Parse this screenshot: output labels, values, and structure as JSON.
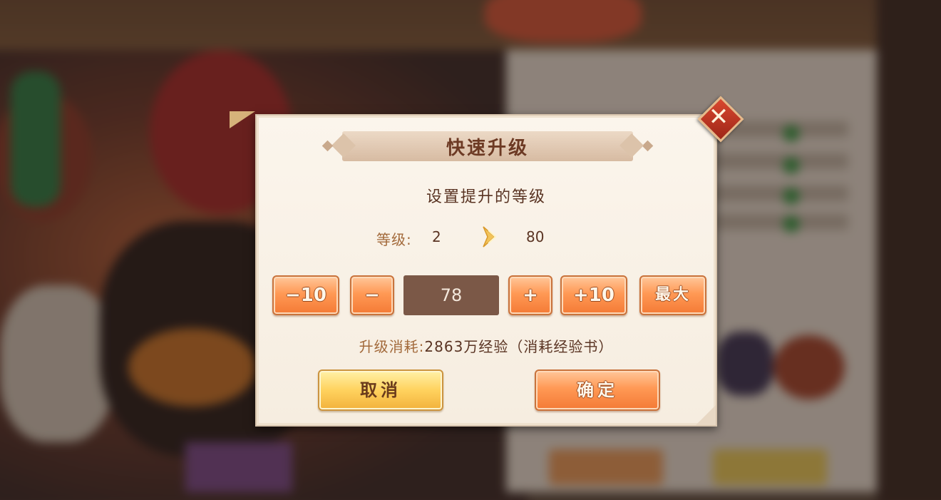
{
  "dialog": {
    "title": "快速升级",
    "subtitle": "设置提升的等级",
    "level": {
      "label": "等级:",
      "from": "2",
      "to": "80"
    },
    "stepper": {
      "minus10_label": "−10",
      "minus_label": "−",
      "value": "78",
      "plus_label": "+",
      "plus10_label": "+10",
      "max_label": "最大"
    },
    "cost": {
      "label": "升级消耗:",
      "value": "2863万经验（消耗经验书）"
    },
    "cancel_label": "取消",
    "confirm_label": "确定",
    "close_icon": "close-icon"
  },
  "colors": {
    "dialog_bg": "#f8f0e4",
    "accent_orange": "#ff9955",
    "accent_yellow": "#ffd25e",
    "title_text": "#6d3a24",
    "label_text": "#a2693a",
    "input_bg": "#7b5847"
  }
}
